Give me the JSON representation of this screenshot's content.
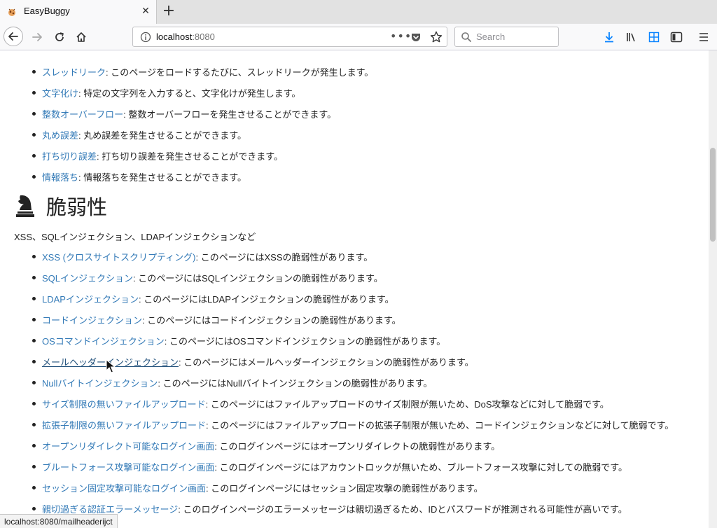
{
  "browser": {
    "tab_title": "EasyBuggy",
    "url_host": "localhost",
    "url_port": ":8080",
    "search_placeholder": "Search",
    "status_url": "localhost:8080/mailheaderijct"
  },
  "colors": {
    "link": "#337ab7",
    "link_hover": "#23527c",
    "text": "#222222"
  },
  "top_items": [
    {
      "link": "スレッドリーク",
      "desc": ": このページをロードするたびに、スレッドリークが発生します。"
    },
    {
      "link": "文字化け",
      "desc": ": 特定の文字列を入力すると、文字化けが発生します。"
    },
    {
      "link": "整数オーバーフロー",
      "desc": ": 整数オーバーフローを発生させることができます。"
    },
    {
      "link": "丸め誤差",
      "desc": ": 丸め誤差を発生させることができます。"
    },
    {
      "link": "打ち切り誤差",
      "desc": ": 打ち切り誤差を発生させることができます。"
    },
    {
      "link": "情報落ち",
      "desc": ": 情報落ちを発生させることができます。"
    }
  ],
  "section": {
    "icon": "chess-knight-icon",
    "title": "脆弱性",
    "description": "XSS、SQLインジェクション、LDAPインジェクションなど"
  },
  "vuln_items": [
    {
      "link": "XSS (クロスサイトスクリプティング)",
      "desc": ": このページにはXSSの脆弱性があります。"
    },
    {
      "link": "SQLインジェクション",
      "desc": ": このページにはSQLインジェクションの脆弱性があります。"
    },
    {
      "link": "LDAPインジェクション",
      "desc": ": このページにはLDAPインジェクションの脆弱性があります。"
    },
    {
      "link": "コードインジェクション",
      "desc": ": このページにはコードインジェクションの脆弱性があります。"
    },
    {
      "link": "OSコマンドインジェクション",
      "desc": ": このページにはOSコマンドインジェクションの脆弱性があります。"
    },
    {
      "link": "メールヘッダーインジェクション",
      "desc": ": このページにはメールヘッダーインジェクションの脆弱性があります。"
    },
    {
      "link": "Nullバイトインジェクション",
      "desc": ": このページにはNullバイトインジェクションの脆弱性があります。"
    },
    {
      "link": "サイズ制限の無いファイルアップロード",
      "desc": ": このページにはファイルアップロードのサイズ制限が無いため、DoS攻撃などに対して脆弱です。"
    },
    {
      "link": "拡張子制限の無いファイルアップロード",
      "desc": ": このページにはファイルアップロードの拡張子制限が無いため、コードインジェクションなどに対して脆弱です。"
    },
    {
      "link": "オープンリダイレクト可能なログイン画面",
      "desc": ": このログインページにはオープンリダイレクトの脆弱性があります。"
    },
    {
      "link": "ブルートフォース攻撃可能なログイン画面",
      "desc": ": このログインページにはアカウントロックが無いため、ブルートフォース攻撃に対しての脆弱です。"
    },
    {
      "link": "セッション固定攻撃可能なログイン画面",
      "desc": ": このログインページにはセッション固定攻撃の脆弱性があります。"
    },
    {
      "link": "親切過ぎる認証エラーメッセージ",
      "desc": ": このログインページのエラーメッセージは親切過ぎるため、IDとパスワードが推測される可能性が高いです。"
    }
  ]
}
